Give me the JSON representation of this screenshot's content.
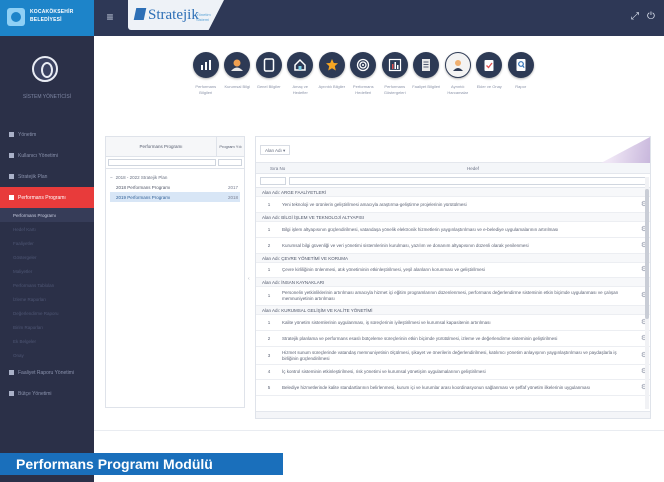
{
  "brand": {
    "org_name": "KOCAKÖKSEHİR BELEDİYESİ",
    "product_name": "Stratejik",
    "product_sub": "Yönetim Sistemi"
  },
  "topbar": {
    "menu_icon": "hamburger-icon",
    "right_icons": [
      "fullscreen-icon",
      "power-icon"
    ]
  },
  "sidebar": {
    "user_name": "SİSTEM YÖNETİCİSİ",
    "items": [
      {
        "label": "Yönetim",
        "icon": "square-icon"
      },
      {
        "label": "Kullanıcı Yönetimi",
        "icon": "user-icon"
      },
      {
        "label": "Stratejik Plan",
        "icon": "chart-icon"
      },
      {
        "label": "Performans Programı",
        "icon": "target-icon",
        "active": true
      }
    ],
    "sub_items": [
      {
        "label": "Performans Programı",
        "current": true
      },
      {
        "label": "Hedef Kartı"
      },
      {
        "label": "Faaliyetler"
      },
      {
        "label": "Göstergeler"
      },
      {
        "label": "Maliyetler"
      },
      {
        "label": "Performans Tabloları"
      },
      {
        "label": "İzleme Raporları"
      },
      {
        "label": "Değerlendirme Raporu"
      },
      {
        "label": "Birim Raporları"
      },
      {
        "label": "Ek Belgeler"
      },
      {
        "label": "Onay"
      }
    ],
    "footer_items": [
      {
        "label": "Faaliyet Raporu Yönetimi",
        "icon": "square-icon"
      },
      {
        "label": "Bütçe Yönetimi",
        "icon": "square-icon"
      }
    ]
  },
  "toolbar": {
    "buttons": [
      {
        "label": "Performans Bilgileri",
        "icon": "building-chart-icon"
      },
      {
        "label": "Kurumsal Bilgi",
        "icon": "people-icon"
      },
      {
        "label": "Genel Bilgiler",
        "icon": "document-icon"
      },
      {
        "label": "Amaç ve Hedefler",
        "icon": "house-icon"
      },
      {
        "label": "Ayrıntılı Bilgiler",
        "icon": "star-icon"
      },
      {
        "label": "Performans Hedefleri",
        "icon": "target-icon"
      },
      {
        "label": "Performans Göstergeleri",
        "icon": "bar-chart-icon"
      },
      {
        "label": "Faaliyet Bilgileri",
        "icon": "file-stack-icon"
      },
      {
        "label": "Ayrıntılı Harcamalar",
        "icon": "person-chat-icon"
      },
      {
        "label": "Ekler ve Onay",
        "icon": "clipboard-check-icon"
      },
      {
        "label": "Rapor",
        "icon": "report-search-icon"
      }
    ]
  },
  "left_panel": {
    "col_program": "Performans Programı",
    "col_year": "Program Yılı",
    "tree_root": "2018 - 2022 Stratejik Plan",
    "rows": [
      {
        "name": "2018 Performans Programı",
        "year": "2017",
        "selected": false
      },
      {
        "name": "2019 Performans Programı",
        "year": "2018",
        "selected": true
      }
    ]
  },
  "right_panel": {
    "select_label": "Alan Adı ▾",
    "col_no": "Sıra No",
    "col_text": "Hedef",
    "groups": [
      {
        "title": "Alan Adı: ARGE FAALİYETLERİ",
        "items": [
          {
            "no": "1",
            "text": "Yeni teknoloji ve ürünlerin geliştirilmesi amacıyla araştırma-geliştirme projelerinin yürütülmesi"
          }
        ]
      },
      {
        "title": "Alan Adı: BİLGİ İŞLEM VE TEKNOLOJİ ALTYAPISI",
        "items": [
          {
            "no": "1",
            "text": "Bilgi işlem altyapısının güçlendirilmesi, vatandaşa yönelik elektronik hizmetlerin yaygınlaştırılması ve e-belediye uygulamalarının artırılması"
          },
          {
            "no": "2",
            "text": "Kurumsal bilgi güvenliği ve veri yönetimi sistemlerinin kurulması, yazılım ve donanım altyapısının düzenli olarak yenilenmesi"
          }
        ]
      },
      {
        "title": "Alan Adı: ÇEVRE YÖNETİMİ VE KORUMA",
        "items": [
          {
            "no": "1",
            "text": "Çevre kirliliğinin önlenmesi, atık yönetiminin etkinleştirilmesi, yeşil alanların korunması ve geliştirilmesi"
          }
        ]
      },
      {
        "title": "Alan Adı: İNSAN KAYNAKLARI",
        "items": [
          {
            "no": "1",
            "text": "Personelin yetkinliklerinin artırılması amacıyla hizmet içi eğitim programlarının düzenlenmesi, performans değerlendirme sisteminin etkin biçimde uygulanması ve çalışan memnuniyetinin artırılması"
          }
        ]
      },
      {
        "title": "Alan Adı: KURUMSAL GELİŞİM VE KALİTE YÖNETİMİ",
        "items": [
          {
            "no": "1",
            "text": "Kalite yönetim sistemlerinin uygulanması, iş süreçlerinin iyileştirilmesi ve kurumsal kapasitenin artırılması"
          },
          {
            "no": "2",
            "text": "Stratejik planlama ve performans esaslı bütçeleme süreçlerinin etkin biçimde yürütülmesi, izleme ve değerlendirme sisteminin geliştirilmesi"
          },
          {
            "no": "3",
            "text": "Hizmet sunum süreçlerinde vatandaş memnuniyetinin ölçülmesi, şikayet ve önerilerin değerlendirilmesi, katılımcı yönetim anlayışının yaygınlaştırılması ve paydaşlarla iş birliğinin güçlendirilmesi"
          },
          {
            "no": "4",
            "text": "İç kontrol sisteminin etkinleştirilmesi, risk yönetimi ve kurumsal yönetişim uygulamalarının geliştirilmesi"
          },
          {
            "no": "5",
            "text": "Belediye hizmetlerinde kalite standartlarının belirlenmesi, kurum içi ve kurumlar arası koordinasyonun sağlanması ve şeffaf yönetim ilkelerinin uygulanması"
          }
        ]
      }
    ]
  },
  "caption": "Performans Programı Modülü"
}
